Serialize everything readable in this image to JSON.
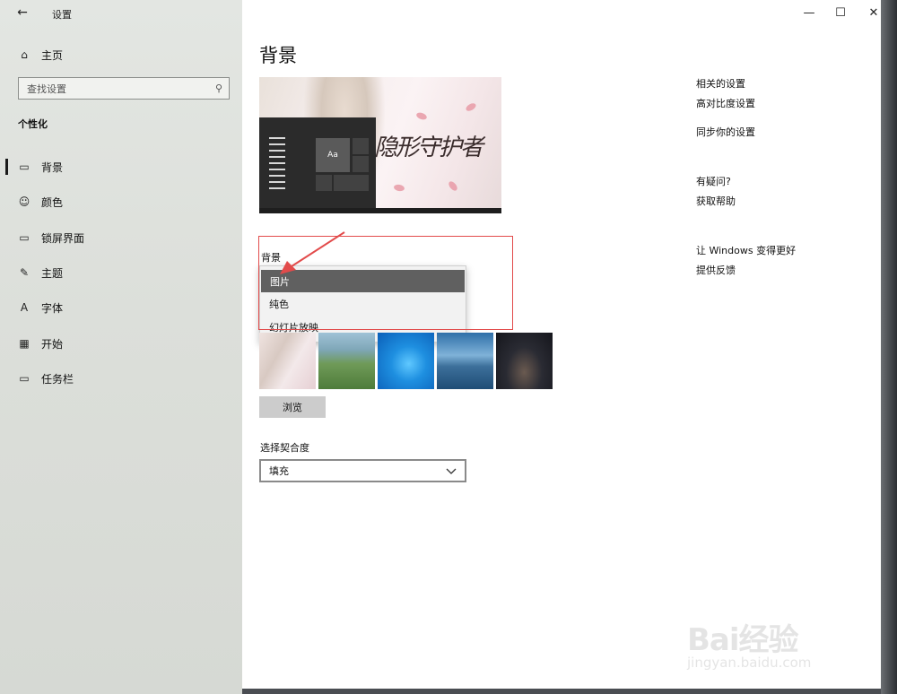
{
  "window": {
    "title": "设置",
    "minimize": "—",
    "maximize": "☐",
    "close": "✕"
  },
  "sidebar": {
    "home_label": "主页",
    "search_placeholder": "查找设置",
    "section": "个性化",
    "items": [
      {
        "label": "背景",
        "icon": "image-icon",
        "glyph": "▭",
        "active": true
      },
      {
        "label": "颜色",
        "icon": "palette-icon",
        "glyph": "☺"
      },
      {
        "label": "锁屏界面",
        "icon": "lock-screen-icon",
        "glyph": "▭"
      },
      {
        "label": "主题",
        "icon": "theme-icon",
        "glyph": "✎"
      },
      {
        "label": "字体",
        "icon": "font-icon",
        "glyph": "A"
      },
      {
        "label": "开始",
        "icon": "start-icon",
        "glyph": "▦"
      },
      {
        "label": "任务栏",
        "icon": "taskbar-icon",
        "glyph": "▭"
      }
    ]
  },
  "main": {
    "title": "背景",
    "preview": {
      "sample_text": "Aa",
      "wallpaper_text": "隐形守护者"
    },
    "background_label": "背景",
    "dropdown_options": [
      {
        "label": "图片",
        "selected": true
      },
      {
        "label": "纯色",
        "selected": false
      },
      {
        "label": "幻灯片放映",
        "selected": false
      }
    ],
    "browse_label": "浏览",
    "fit_label": "选择契合度",
    "fit_value": "填充"
  },
  "related": {
    "heading": "相关的设置",
    "links": [
      "高对比度设置",
      "同步你的设置"
    ],
    "question_heading": "有疑问?",
    "help_link": "获取帮助",
    "improve_heading": "让 Windows 变得更好",
    "feedback_link": "提供反馈"
  },
  "watermark": {
    "text": "Bai经验",
    "url": "jingyan.baidu.com"
  },
  "colors": {
    "highlight": "#606060",
    "annotation": "#e24b4b"
  }
}
